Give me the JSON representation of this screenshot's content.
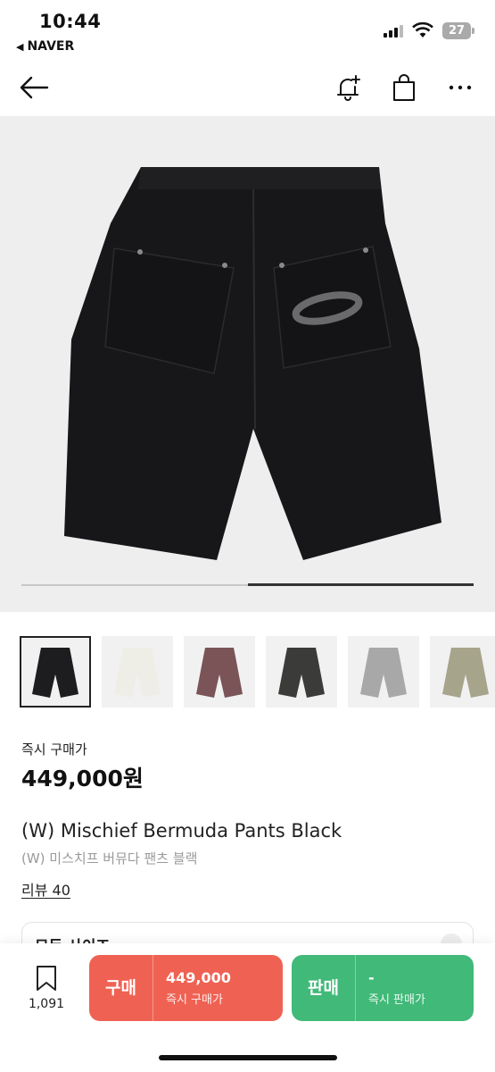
{
  "status": {
    "time": "10:44",
    "back_app": "NAVER",
    "battery": "27"
  },
  "header": {
    "back_icon": "arrow-left-icon",
    "alert_icon": "bell-plus-icon",
    "bag_icon": "shopping-bag-icon",
    "more_icon": "more-dots-icon"
  },
  "gallery": {
    "progress": 0.5,
    "thumbnails": [
      {
        "color": "#1d1d1f",
        "selected": true
      },
      {
        "color": "#efeee6",
        "selected": false
      },
      {
        "color": "#7a5457",
        "selected": false
      },
      {
        "color": "#3b3c3a",
        "selected": false
      },
      {
        "color": "#a9a8a8",
        "selected": false
      },
      {
        "color": "#a7a48c",
        "selected": false
      }
    ]
  },
  "product": {
    "instant_label": "즉시 구매가",
    "price": "449,000원",
    "title_en": "(W) Mischief Bermuda Pants Black",
    "title_ko": "(W) 미스치프 버뮤다 팬츠 블랙",
    "review": "리뷰 40",
    "size_label": "모든 사이즈"
  },
  "bottom_bar": {
    "wish_count": "1,091",
    "buy": {
      "label": "구매",
      "value": "449,000",
      "sub": "즉시 구매가",
      "color": "#ef6253"
    },
    "sell": {
      "label": "판매",
      "value": "-",
      "sub": "즉시 판매가",
      "color": "#41b979"
    }
  }
}
